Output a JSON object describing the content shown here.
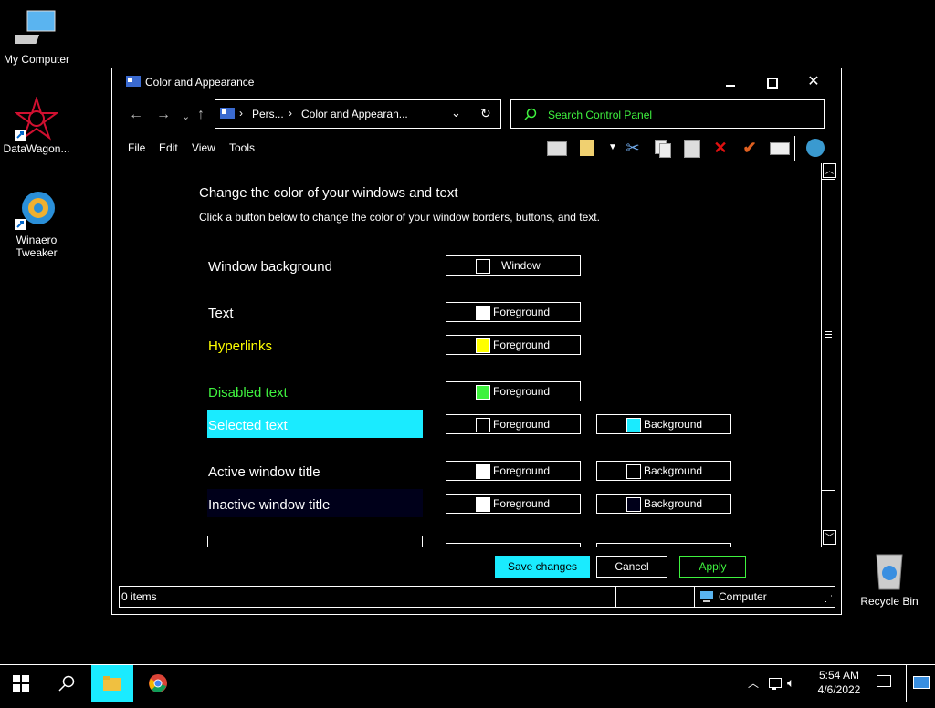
{
  "desktop": {
    "icons": [
      {
        "label": "My Computer"
      },
      {
        "label": "DataWagon..."
      },
      {
        "label": "Winaero Tweaker"
      },
      {
        "label": "Recycle Bin"
      }
    ]
  },
  "window": {
    "title": "Color and Appearance",
    "address": {
      "crumb1": "Pers...",
      "crumb2": "Color and Appearan..."
    },
    "search_placeholder": "Search Control Panel",
    "menu": [
      "File",
      "Edit",
      "View",
      "Tools"
    ],
    "heading": "Change the color of your windows and text",
    "subheading": "Click a button below to change the color of your window borders, buttons, and text.",
    "rows": [
      {
        "label": "Window background",
        "color": "#ffffff",
        "fg_label": "Window",
        "fg_swatch": "#000000"
      },
      {
        "label": "Text",
        "color": "#ffffff",
        "fg_label": "Foreground",
        "fg_swatch": "#ffffff"
      },
      {
        "label": "Hyperlinks",
        "color": "#ffff00",
        "fg_label": "Foreground",
        "fg_swatch": "#ffff00"
      },
      {
        "label": "Disabled text",
        "color": "#3ff23f",
        "fg_label": "Foreground",
        "fg_swatch": "#3ff23f"
      },
      {
        "label": "Selected text",
        "color": "#ffffff",
        "bg": "#1aebff",
        "fg_label": "Foreground",
        "fg_swatch": "#000000",
        "bg_label": "Background",
        "bg_swatch": "#1aebff"
      },
      {
        "label": "Active window title",
        "color": "#ffffff",
        "fg_label": "Foreground",
        "fg_swatch": "#ffffff",
        "bg_label": "Background",
        "bg_swatch": "#000000"
      },
      {
        "label": "Inactive window title",
        "color": "#ffffff",
        "bg": "#00001a",
        "fg_label": "Foreground",
        "fg_swatch": "#ffffff",
        "bg_label": "Background",
        "bg_swatch": "#00001a"
      }
    ],
    "buttons": {
      "save": "Save changes",
      "cancel": "Cancel",
      "apply": "Apply"
    },
    "status": {
      "items": "0 items",
      "location": "Computer"
    }
  },
  "taskbar": {
    "time": "5:54 AM",
    "date": "4/6/2022"
  },
  "colors": {
    "accent_cyan": "#1aebff",
    "accent_green": "#3ff23f",
    "hyperlink_yellow": "#ffff00"
  }
}
